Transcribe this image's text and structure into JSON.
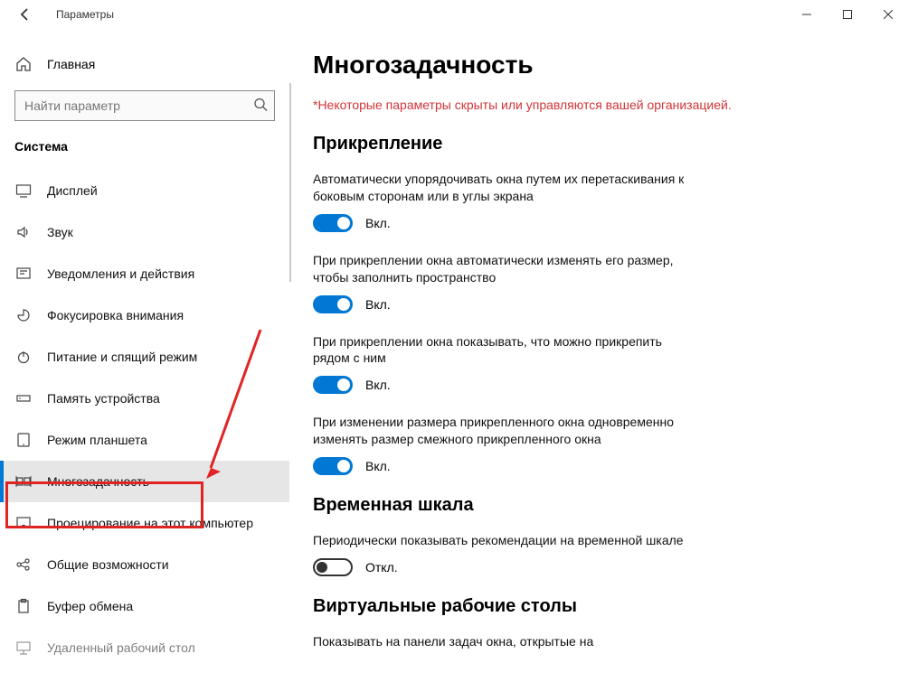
{
  "window": {
    "title": "Параметры"
  },
  "sidebar": {
    "home_label": "Главная",
    "search_placeholder": "Найти параметр",
    "group_title": "Система",
    "items": [
      {
        "key": "display",
        "label": "Дисплей"
      },
      {
        "key": "sound",
        "label": "Звук"
      },
      {
        "key": "notifications",
        "label": "Уведомления и действия"
      },
      {
        "key": "focus",
        "label": "Фокусировка внимания"
      },
      {
        "key": "power",
        "label": "Питание и спящий режим"
      },
      {
        "key": "storage",
        "label": "Память устройства"
      },
      {
        "key": "tablet",
        "label": "Режим планшета"
      },
      {
        "key": "multitasking",
        "label": "Многозадачность"
      },
      {
        "key": "projecting",
        "label": "Проецирование на этот компьютер"
      },
      {
        "key": "shared",
        "label": "Общие возможности"
      },
      {
        "key": "clipboard",
        "label": "Буфер обмена"
      },
      {
        "key": "remote",
        "label": "Удаленный рабочий стол"
      }
    ]
  },
  "content": {
    "page_title": "Многозадачность",
    "org_notice": "*Некоторые параметры скрыты или управляются вашей организацией.",
    "snap_section_title": "Прикрепление",
    "settings": [
      {
        "text": "Автоматически упорядочивать окна путем их перетаскивания к боковым сторонам или в углы экрана",
        "on": true,
        "state_label": "Вкл."
      },
      {
        "text": "При прикреплении окна автоматически изменять его размер, чтобы заполнить пространство",
        "on": true,
        "state_label": "Вкл."
      },
      {
        "text": "При прикреплении окна показывать, что можно прикрепить рядом с ним",
        "on": true,
        "state_label": "Вкл."
      },
      {
        "text": "При изменении размера прикрепленного окна одновременно изменять размер смежного прикрепленного окна",
        "on": true,
        "state_label": "Вкл."
      }
    ],
    "timeline_section_title": "Временная шкала",
    "timeline": {
      "text": "Периодически показывать рекомендации на временной шкале",
      "on": false,
      "state_label": "Откл."
    },
    "virtual_desktops_title": "Виртуальные рабочие столы",
    "virtual_desktops_text": "Показывать на панели задач окна, открытые на"
  }
}
